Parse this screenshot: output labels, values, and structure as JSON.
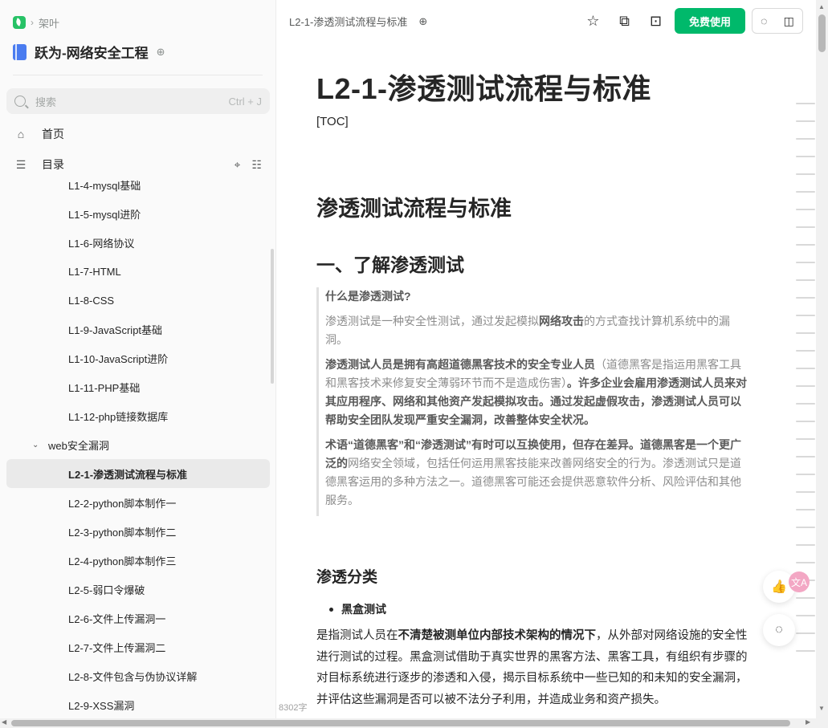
{
  "sidebar": {
    "breadcrumb": [
      "›",
      "架叶"
    ],
    "book_title": "跃为-网络安全工程",
    "search": {
      "placeholder": "搜索",
      "shortcut": "Ctrl + J"
    },
    "home_label": "首页",
    "catalog_label": "目录",
    "tree": [
      {
        "label": "L1-4-mysql基础",
        "level": 2
      },
      {
        "label": "L1-5-mysql进阶",
        "level": 2
      },
      {
        "label": "L1-6-网络协议",
        "level": 2
      },
      {
        "label": "L1-7-HTML",
        "level": 2
      },
      {
        "label": "L1-8-CSS",
        "level": 2
      },
      {
        "label": "L1-9-JavaScript基础",
        "level": 2
      },
      {
        "label": "L1-10-JavaScript进阶",
        "level": 2
      },
      {
        "label": "L1-11-PHP基础",
        "level": 2
      },
      {
        "label": "L1-12-php链接数据库",
        "level": 2
      },
      {
        "label": "web安全漏洞",
        "level": 1,
        "expanded": true
      },
      {
        "label": "L2-1-渗透测试流程与标准",
        "level": 2,
        "selected": true
      },
      {
        "label": "L2-2-python脚本制作一",
        "level": 2
      },
      {
        "label": "L2-3-python脚本制作二",
        "level": 2
      },
      {
        "label": "L2-4-python脚本制作三",
        "level": 2
      },
      {
        "label": "L2-5-弱口令爆破",
        "level": 2
      },
      {
        "label": "L2-6-文件上传漏洞一",
        "level": 2
      },
      {
        "label": "L2-7-文件上传漏洞二",
        "level": 2
      },
      {
        "label": "L2-8-文件包含与伪协议详解",
        "level": 2
      },
      {
        "label": "L2-9-XSS漏洞",
        "level": 2
      }
    ]
  },
  "header": {
    "doc_title": "L2-1-渗透测试流程与标准",
    "free_button": "免费使用",
    "icons": [
      "star-icon",
      "copy-icon",
      "present-icon"
    ]
  },
  "content": {
    "title": "L2-1-渗透测试流程与标准",
    "toc": "[TOC]",
    "h2": "渗透测试流程与标准",
    "h3": "一、了解渗透测试",
    "quote": {
      "q1_title": "什么是渗透测试?",
      "q2_a": "渗透测试是一种安全性测试，通过发起模拟",
      "q2_b": "网络攻击",
      "q2_c": "的方式查找计算机系统中的漏洞。",
      "q3_a": "渗透测试人员是拥有高超道德黑客技术的安全专业人员",
      "q3_b": "（道德黑客是指运用黑客工具和黑客技术来修复安全薄弱环节而不是造成伤害）",
      "q3_c": "。许多企业会雇用渗透测试人员来对其应用程序、网络和其他资产发起模拟攻击。通过发起虚假攻击，渗透测试人员可以帮助安全团队发现严重安全漏洞，改善整体安全状况。",
      "q4_a": "术语“道德黑客”和“渗透测试”有时可以互换使用，但存在差异。道德黑客是一个更广泛的",
      "q4_b": "网络安全领域，包括任何运用黑客技能来改善网络安全的行为。渗透测试只是道德黑客运用的多种方法之一。道德黑客可能还会提供恶意软件分析、风险评估和其他服务。"
    },
    "h4": "渗透分类",
    "bullet": "黑盒测试",
    "para_a": "是指测试人员在",
    "para_b": "不清楚被测单位内部技术架构的情况下",
    "para_c": "，从外部对网络设施的安全性进行测试的过程。黑盒测试借助于真实世界的黑客方法、黑客工具，有组织有步骤的对目标系统进行逐步的渗透和入侵，揭示目标系统中一些已知的和未知的安全漏洞，并评估这些漏洞是否可以被不法分子利用，并造成业务和资产损失。"
  },
  "footer": {
    "word_count": "8302字"
  },
  "colors": {
    "accent": "#00b96b",
    "selected_bg": "#eaeaea"
  }
}
